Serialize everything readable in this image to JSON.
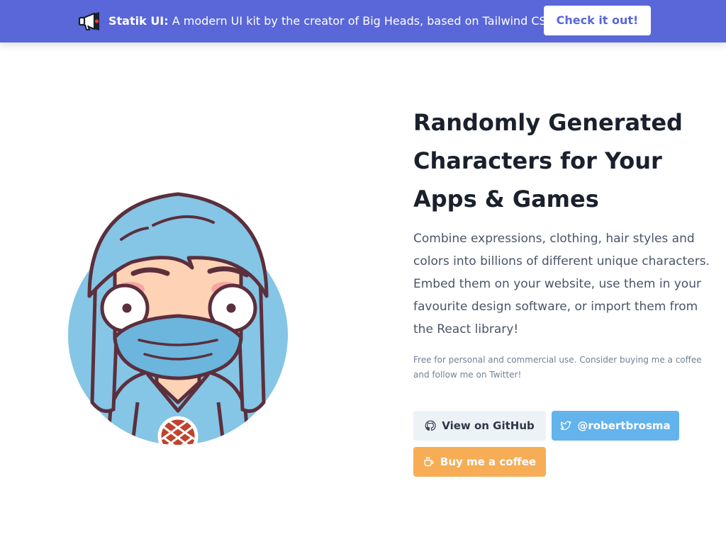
{
  "banner": {
    "brand": "Statik UI:",
    "message": "A modern UI kit by the creator of Big Heads, based on Tailwind CSS",
    "cta_label": "Check it out!",
    "icon": "megaphone-icon",
    "color": "#5a67d8"
  },
  "hero": {
    "avatar_icon": "big-head-avatar",
    "title": "Randomly Generated Characters for Your Apps & Games",
    "description": "Combine expressions, clothing, hair styles and colors into billions of different unique characters. Embed them on your website, use them in your favourite design software, or import them from the React library!",
    "note": "Free for personal and commercial use. Consider buying me a coffee and follow me on Twitter!"
  },
  "actions": {
    "github_label": "View on GitHub",
    "twitter_label": "@robertbrosma",
    "coffee_label": "Buy me a coffee",
    "github_icon": "github-icon",
    "twitter_icon": "twitter-icon",
    "coffee_icon": "coffee-cup-icon",
    "github_color": "#edf2f7",
    "twitter_color": "#63b3ed",
    "coffee_color": "#f6ad55"
  }
}
